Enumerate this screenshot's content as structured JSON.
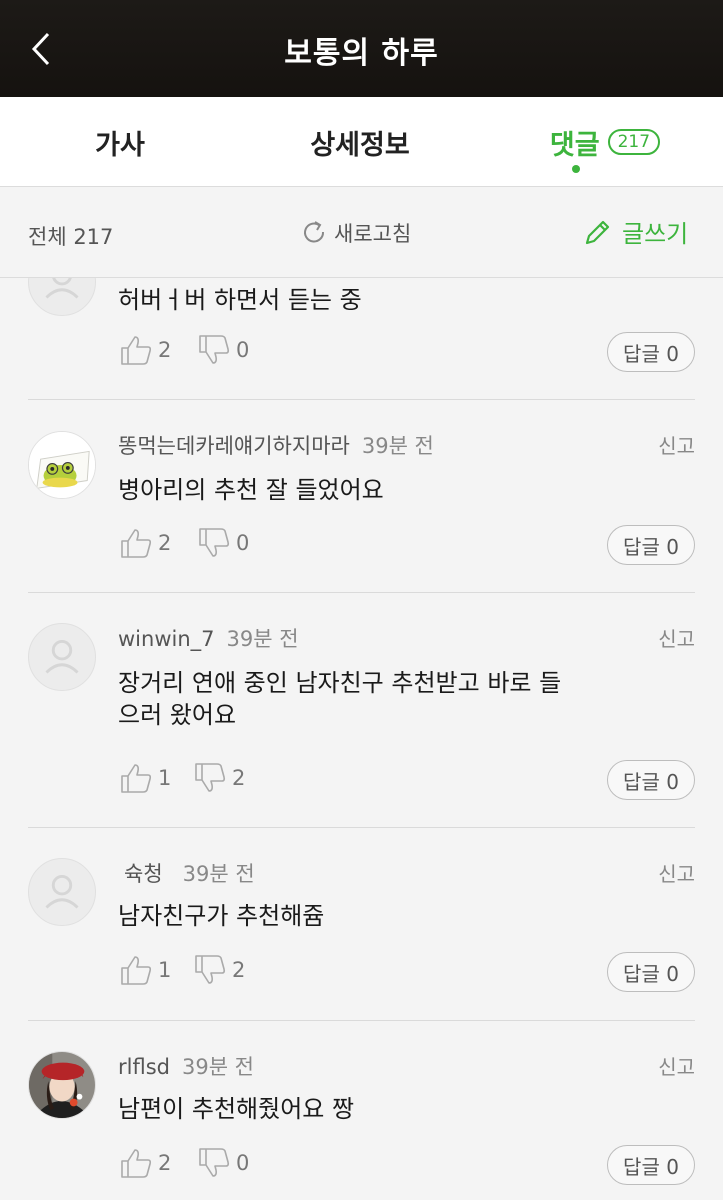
{
  "header": {
    "title": "보통의 하루"
  },
  "tabs": {
    "lyrics": "가사",
    "info": "상세정보",
    "comments": "댓글",
    "comments_count": "217"
  },
  "toolbar": {
    "total": "전체 217",
    "refresh": "새로고침",
    "write": "글쓰기"
  },
  "colors": {
    "accent": "#3db43d",
    "header_bg": "#1d1a17"
  },
  "comments": [
    {
      "author": "",
      "time": "",
      "report": "",
      "text": "허버ㅓ버 하면서 듣는 중",
      "likes": "2",
      "dislikes": "0",
      "reply": "답글 0",
      "avatar": "default-avatar-icon"
    },
    {
      "author": "똥먹는데카레얘기하지마라",
      "time": "39분 전",
      "report": "신고",
      "text": "병아리의 추천 잘 들었어요",
      "likes": "2",
      "dislikes": "0",
      "reply": "답글 0",
      "avatar": "frog-avatar-icon"
    },
    {
      "author": "winwin_7",
      "time": "39분 전",
      "report": "신고",
      "text": "장거리 연애 중인 남자친구 추천받고 바로 들으러 왔어요",
      "likes": "1",
      "dislikes": "2",
      "reply": "답글 0",
      "avatar": "default-avatar-icon"
    },
    {
      "author": "슉청",
      "time": "39분 전",
      "report": "신고",
      "text": "남자친구가 추천해쥼",
      "likes": "1",
      "dislikes": "2",
      "reply": "답글 0",
      "avatar": "default-avatar-icon"
    },
    {
      "author": "rlflsd",
      "time": "39분 전",
      "report": "신고",
      "text": "남편이 추천해줬어요 짱",
      "likes": "2",
      "dislikes": "0",
      "reply": "답글 0",
      "avatar": "photo-avatar-icon"
    }
  ]
}
